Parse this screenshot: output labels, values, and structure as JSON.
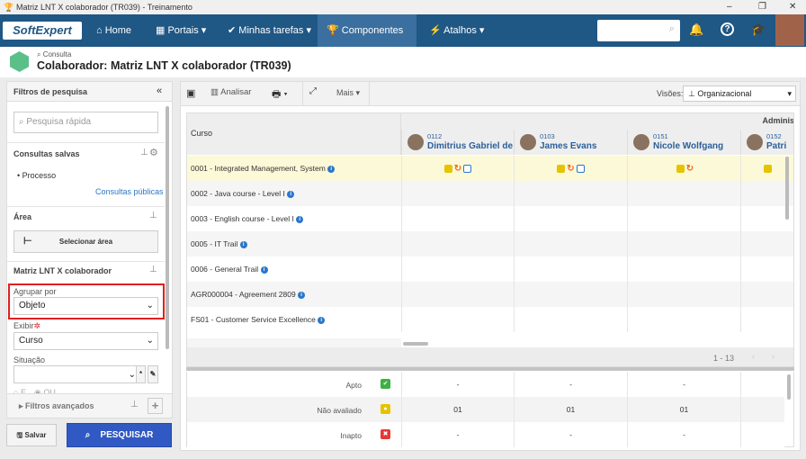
{
  "window": {
    "title": "Matriz LNT X colaborador (TR039) - Treinamento",
    "minimize": "‒",
    "restore": "❐",
    "close": "✕"
  },
  "nav": {
    "logo": "SoftExpert",
    "items": [
      {
        "label": "Home"
      },
      {
        "label": "Portais ▾"
      },
      {
        "label": "Minhas tarefas ▾"
      },
      {
        "label": "Componentes ▾"
      },
      {
        "label": "Atalhos ▾"
      }
    ]
  },
  "header": {
    "breadcrumb": "Consulta",
    "title": "Colaborador: Matriz LNT X colaborador (TR039)"
  },
  "filters": {
    "title": "Filtros de pesquisa",
    "quick_search_placeholder": "Pesquisa rápida",
    "saved_title": "Consultas salvas",
    "saved_items": [
      "Processo"
    ],
    "public_link": "Consultas públicas",
    "area_title": "Área",
    "select_area": "Selecionar área",
    "matrix_title": "Matriz LNT X colaborador",
    "group_label": "Agrupar por",
    "group_value": "Objeto",
    "show_label": "Exibir",
    "show_value": "Curso",
    "status_label": "Situação",
    "radio_e": "E",
    "radio_ou": "OU",
    "advanced": "Filtros avançados",
    "save": "Salvar",
    "search": "PESQUISAR"
  },
  "toolbar": {
    "analyze": "Analisar",
    "more": "Mais ▾",
    "views_label": "Visões:",
    "views_value": "Organizacional"
  },
  "grid": {
    "group_header": "Administ",
    "course_header": "Curso",
    "people": [
      {
        "code": "0112",
        "name": "Dimitrius Gabriel de F"
      },
      {
        "code": "0103",
        "name": "James Evans"
      },
      {
        "code": "0151",
        "name": "Nicole Wolfgang"
      },
      {
        "code": "0152",
        "name": "Patri"
      }
    ],
    "rows": [
      "0001 - Integrated Management, System",
      "0002 - Java course - Level I",
      "0003 - English course - Level I",
      "0005 - IT Trail",
      "0006 - General Trail",
      "AGR000004 - Agreement 2809",
      "FS01 - Customer Service Excellence"
    ],
    "pagination": "1 - 13"
  },
  "summary": [
    {
      "label": "Apto",
      "values": [
        "-",
        "-",
        "-"
      ],
      "color": "#3cb043"
    },
    {
      "label": "Não avaliado",
      "values": [
        "01",
        "01",
        "01"
      ],
      "color": "#e5c300"
    },
    {
      "label": "Inapto",
      "values": [
        "-",
        "-",
        "-"
      ],
      "color": "#e53935"
    }
  ]
}
